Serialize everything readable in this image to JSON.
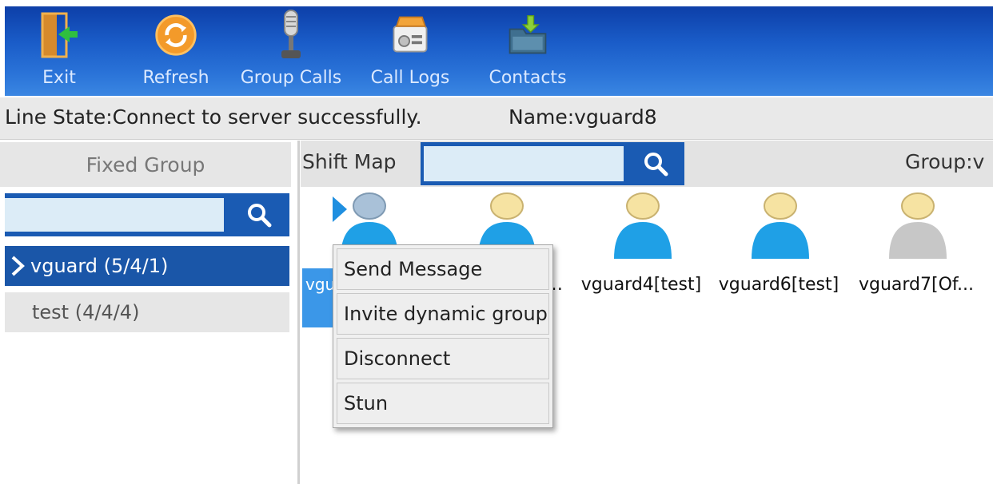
{
  "toolbar": {
    "buttons": [
      {
        "label": "Exit",
        "icon": "exit-door-icon"
      },
      {
        "label": "Refresh",
        "icon": "refresh-icon"
      },
      {
        "label": "Group Calls",
        "icon": "microphone-icon"
      },
      {
        "label": "Call Logs",
        "icon": "call-logs-icon"
      },
      {
        "label": "Contacts",
        "icon": "contacts-folder-icon"
      }
    ]
  },
  "status": {
    "line_state": "Line State:Connect to server successfully.",
    "name": "Name:vguard8"
  },
  "left_panel": {
    "header": "Fixed Group",
    "search_value": "",
    "groups": [
      {
        "label": "vguard (5/4/1)",
        "selected": true
      },
      {
        "label": "test (4/4/4)",
        "selected": false
      }
    ]
  },
  "map": {
    "shift_label": "Shift Map",
    "search_value": "",
    "group_label": "Group:v"
  },
  "users": [
    {
      "label": "",
      "color": "#1fa0e6",
      "head": "#a9c1d8"
    },
    {
      "label": "…",
      "color": "#1fa0e6",
      "head": "#f6e3a2"
    },
    {
      "label": "vguard4[test]",
      "color": "#1fa0e6",
      "head": "#f6e3a2"
    },
    {
      "label": "vguard6[test]",
      "color": "#1fa0e6",
      "head": "#f6e3a2"
    },
    {
      "label": "vguard7[Of...",
      "color": "#c7c7c7",
      "head": "#f6e3a2"
    }
  ],
  "selected_user_partial": "vgu",
  "context_menu": {
    "items": [
      "Send Message",
      "Invite dynamic group",
      "Disconnect",
      "Stun"
    ]
  },
  "colors": {
    "toolbar": "#1a5cc8",
    "selection": "#1a56a8",
    "online": "#1fa0e6",
    "offline": "#c7c7c7"
  }
}
